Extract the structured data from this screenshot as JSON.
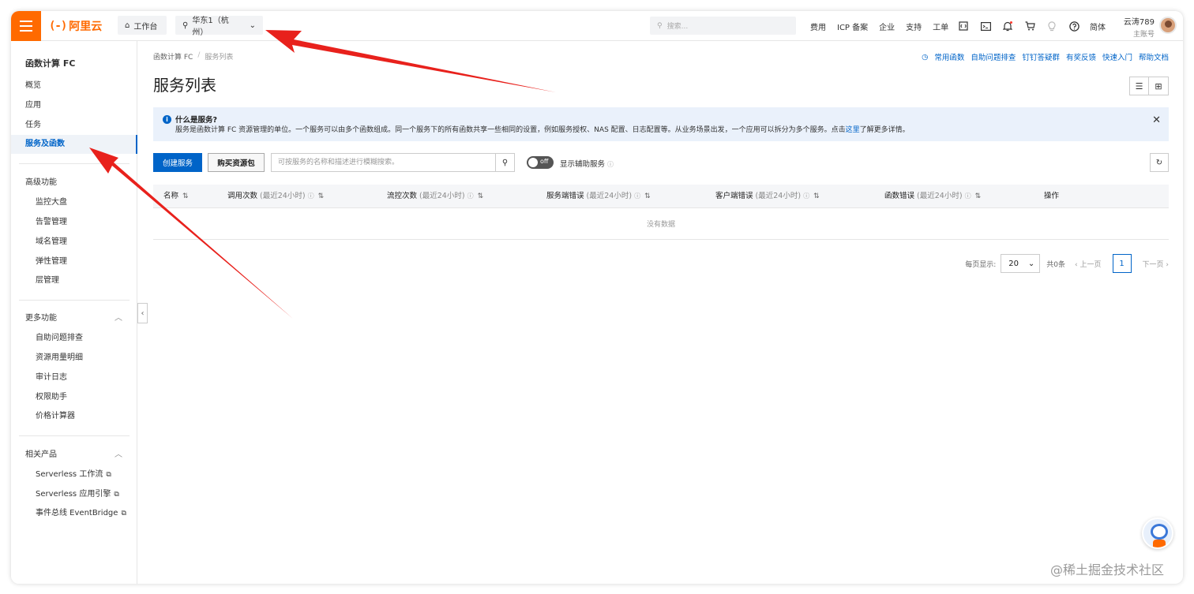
{
  "topbar": {
    "logo_mark": "(-)",
    "logo_text": "阿里云",
    "workbench": "工作台",
    "region": "华东1（杭州）",
    "search_placeholder": "搜索...",
    "links": [
      "费用",
      "ICP 备案",
      "企业",
      "支持",
      "工单"
    ],
    "lang": "简体",
    "user_name": "云涛789",
    "user_role": "主账号"
  },
  "sidebar": {
    "title": "函数计算 FC",
    "items": [
      "概览",
      "应用",
      "任务",
      "服务及函数"
    ],
    "advanced_title": "高级功能",
    "advanced_items": [
      "监控大盘",
      "告警管理",
      "域名管理",
      "弹性管理",
      "层管理"
    ],
    "more_title": "更多功能",
    "more_items": [
      "自助问题排查",
      "资源用量明细",
      "审计日志",
      "权限助手",
      "价格计算器"
    ],
    "related_title": "相关产品",
    "related_items": [
      "Serverless 工作流",
      "Serverless 应用引擎",
      "事件总线 EventBridge"
    ]
  },
  "main": {
    "breadcrumb": [
      "函数计算 FC",
      "服务列表"
    ],
    "quick_links": [
      "常用函数",
      "自助问题排查",
      "钉钉答疑群",
      "有奖反馈",
      "快速入门",
      "帮助文档"
    ],
    "page_title": "服务列表",
    "notice": {
      "title": "什么是服务?",
      "body_prefix": "服务是函数计算 FC 资源管理的单位。一个服务可以由多个函数组成。同一个服务下的所有函数共享一些相同的设置，例如服务授权、NAS 配置、日志配置等。从业务场景出发，一个应用可以拆分为多个服务。点击",
      "link": "这里",
      "body_suffix": "了解更多详情。"
    },
    "toolbar": {
      "create": "创建服务",
      "buy": "购买资源包",
      "search_placeholder": "可按服务的名称和描述进行模糊搜索。",
      "toggle_state": "off",
      "aux_label": "显示辅助服务"
    },
    "table": {
      "columns": [
        {
          "name": "名称",
          "unit": ""
        },
        {
          "name": "调用次数",
          "unit": "(最近24小时)"
        },
        {
          "name": "流控次数",
          "unit": "(最近24小时)"
        },
        {
          "name": "服务端错误",
          "unit": "(最近24小时)"
        },
        {
          "name": "客户端错误",
          "unit": "(最近24小时)"
        },
        {
          "name": "函数错误",
          "unit": "(最近24小时)"
        },
        {
          "name": "操作",
          "unit": ""
        }
      ],
      "empty": "没有数据"
    },
    "pager": {
      "page_size_label": "每页显示:",
      "page_size": "20",
      "total": "共0条",
      "prev": "上一页",
      "current": "1",
      "next": "下一页"
    }
  },
  "watermark": "@稀土掘金技术社区",
  "colors": {
    "brand": "#ff6a00",
    "primary": "#0064c8",
    "arrow": "#e8211c"
  }
}
